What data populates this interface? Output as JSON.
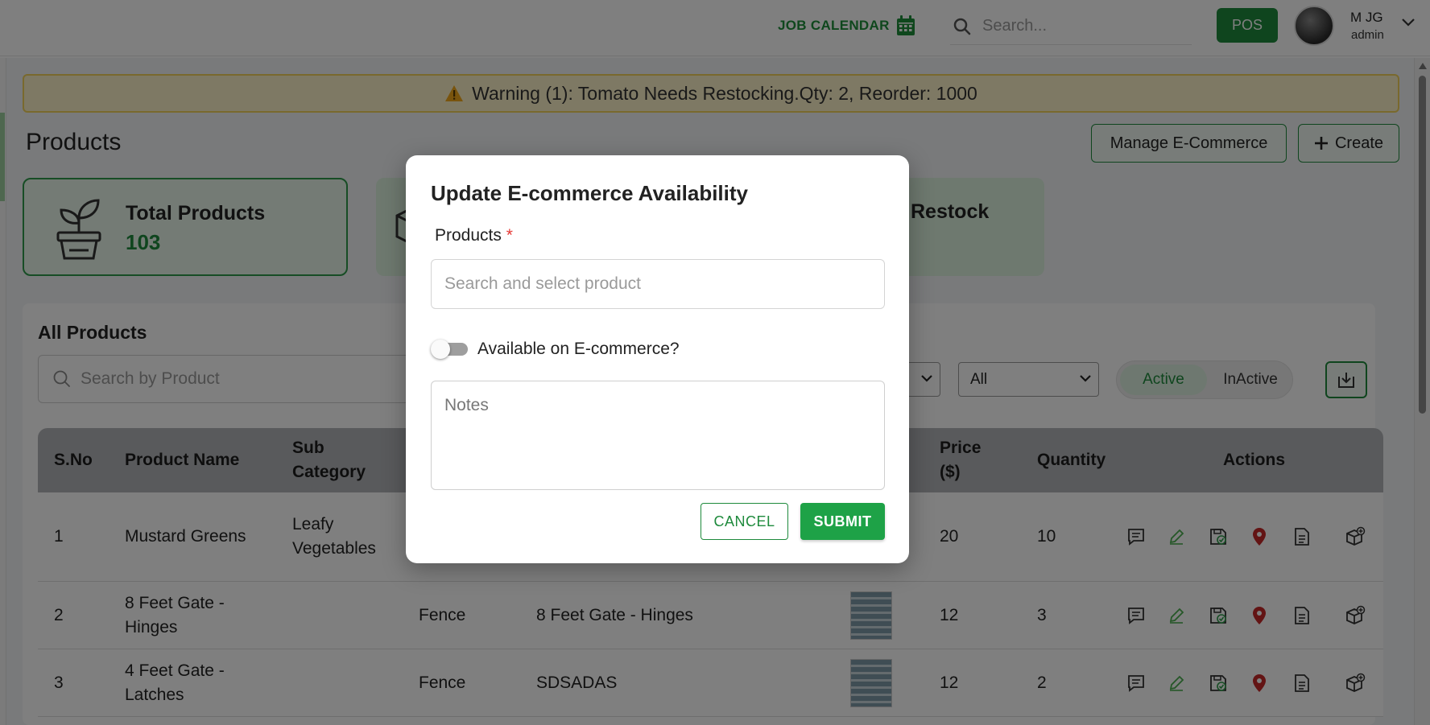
{
  "header": {
    "job_calendar": "JOB CALENDAR",
    "search_placeholder": "Search...",
    "pos": "POS",
    "user_name": "M JG",
    "user_role": "admin"
  },
  "warning": {
    "text": "Warning (1): Tomato Needs Restocking.Qty: 2, Reorder: 1000"
  },
  "page": {
    "title": "Products",
    "manage_ecommerce": "Manage E-Commerce",
    "create": "Create"
  },
  "stats": {
    "total_label": "Total Products",
    "total_value": "103",
    "restock_label": "Restock"
  },
  "list": {
    "heading": "All Products",
    "search_placeholder": "Search by Product",
    "filter_all": "All",
    "active": "Active",
    "inactive": "InActive"
  },
  "table": {
    "headers": {
      "sno": "S.No",
      "name": "Product Name",
      "sub": "Sub Category",
      "price": "Price ($)",
      "qty": "Quantity",
      "actions": "Actions"
    },
    "rows": [
      {
        "sno": "1",
        "name": "Mustard Greens",
        "sub": "Leafy Vegetables",
        "category": "",
        "description": "",
        "price": "20",
        "qty": "10"
      },
      {
        "sno": "2",
        "name": "8 Feet Gate - Hinges",
        "sub": "",
        "category": "Fence",
        "description": "8 Feet Gate - Hinges",
        "price": "12",
        "qty": "3"
      },
      {
        "sno": "3",
        "name": "4 Feet Gate - Latches",
        "sub": "",
        "category": "Fence",
        "description": "SDSADAS",
        "price": "12",
        "qty": "2"
      }
    ]
  },
  "modal": {
    "title": "Update E-commerce Availability",
    "products_label": "Products",
    "required_mark": "*",
    "products_placeholder": "Search and select product",
    "available_label": "Available on E-commerce?",
    "notes_placeholder": "Notes",
    "cancel": "CANCEL",
    "submit": "SUBMIT"
  },
  "colors": {
    "brand_green": "#1e8a3c",
    "warning_bg": "#fdf3c8",
    "location_red": "#c62828"
  }
}
